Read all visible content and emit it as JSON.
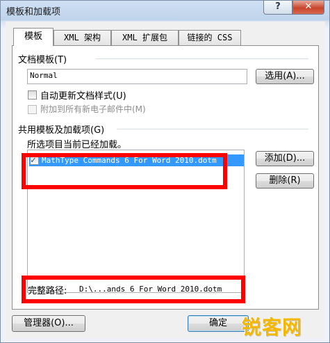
{
  "window": {
    "title": "模板和加载项",
    "help_label": "?",
    "close_label": "✕"
  },
  "tabs": [
    {
      "label": "模板",
      "active": true
    },
    {
      "label": "XML 架构",
      "active": false
    },
    {
      "label": "XML 扩展包",
      "active": false
    },
    {
      "label": "链接的 CSS",
      "active": false
    }
  ],
  "document_template": {
    "section_label": "文档模板(T)",
    "value": "Normal",
    "select_button": "选用(A)...",
    "auto_update_label": "自动更新文档样式(U)",
    "auto_update_checked": false,
    "attach_all_label": "附加到所有新电子邮件中(M)",
    "attach_all_enabled": false
  },
  "global_templates": {
    "section_label": "共用模板及加载项(G)",
    "subtitle": "所选项目当前已经加载。",
    "items": [
      {
        "text": "MathType Commands 6 For Word 2010.dotm",
        "checked": true,
        "selected": true
      }
    ],
    "add_button": "添加(D)...",
    "remove_button": "删除(R)",
    "full_path_label": "完整路径:",
    "full_path_value": "D:\\...ands 6 For Word 2010.dotm"
  },
  "footer": {
    "organizer_button": "管理器(O)...",
    "ok_button": "确定"
  },
  "watermark": {
    "text": "锐客网"
  },
  "colors": {
    "highlight": "#ff0000",
    "selection": "#3399ff",
    "watermark": "#f5b800"
  }
}
